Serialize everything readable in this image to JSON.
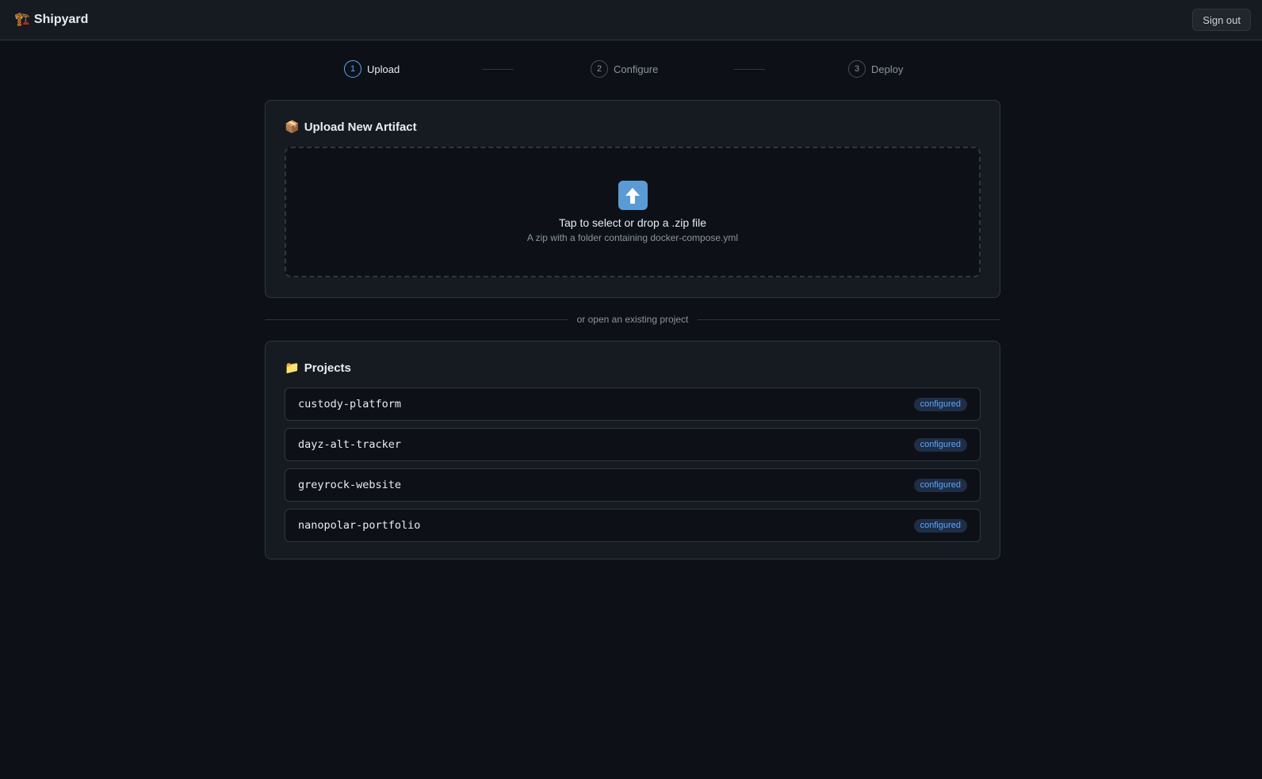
{
  "header": {
    "brand_icon": "🏗️",
    "brand_name": "Shipyard",
    "signout_label": "Sign out"
  },
  "steps": [
    {
      "num": "1",
      "label": "Upload",
      "active": true
    },
    {
      "num": "2",
      "label": "Configure",
      "active": false
    },
    {
      "num": "3",
      "label": "Deploy",
      "active": false
    }
  ],
  "upload": {
    "title_icon": "📦",
    "title": "Upload New Artifact",
    "icon": "upload-arrow-icon",
    "drop_text": "Tap to select or drop a .zip file",
    "drop_hint": "A zip with a folder containing docker-compose.yml"
  },
  "divider_text": "or open an existing project",
  "projects": {
    "title_icon": "📁",
    "title": "Projects",
    "items": [
      {
        "name": "custody-platform",
        "status": "configured"
      },
      {
        "name": "dayz-alt-tracker",
        "status": "configured"
      },
      {
        "name": "greyrock-website",
        "status": "configured"
      },
      {
        "name": "nanopolar-portfolio",
        "status": "configured"
      }
    ]
  },
  "colors": {
    "accent": "#58a6ff",
    "background": "#0d1117",
    "surface": "#161b22",
    "border": "#30363d"
  }
}
